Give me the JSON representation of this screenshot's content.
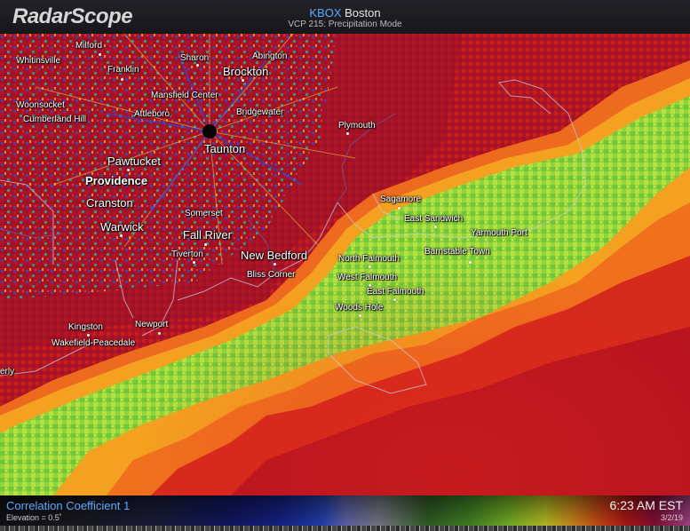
{
  "app": {
    "logo": "RadarScope"
  },
  "header": {
    "station_code": "KBOX",
    "station_name": "Boston",
    "vcp_line": "VCP 215: Precipitation Mode"
  },
  "footer": {
    "product": "Correlation Coefficient 1",
    "elevation": "Elevation = 0.5˚",
    "time": "6:23 AM EST",
    "date": "3/2/19"
  },
  "colors": {
    "accent_blue": "#5aa9ff",
    "cc_low": "#b41a1e",
    "cc_mid": "#f08a1c",
    "cc_high": "#7fd62e",
    "background_bar": "#17171b"
  },
  "places": [
    {
      "name": "Milford"
    },
    {
      "name": "Whitinsville"
    },
    {
      "name": "Franklin"
    },
    {
      "name": "Sharon"
    },
    {
      "name": "Abington"
    },
    {
      "name": "Brockton"
    },
    {
      "name": "Mansfield Center"
    },
    {
      "name": "Woonsocket"
    },
    {
      "name": "Bridgewater"
    },
    {
      "name": "Cumberland Hill"
    },
    {
      "name": "Plymouth"
    },
    {
      "name": "Attleboro"
    },
    {
      "name": "Taunton"
    },
    {
      "name": "Pawtucket"
    },
    {
      "name": "Providence"
    },
    {
      "name": "Cranston"
    },
    {
      "name": "Somerset"
    },
    {
      "name": "Warwick"
    },
    {
      "name": "Fall River"
    },
    {
      "name": "Tiverton"
    },
    {
      "name": "New Bedford"
    },
    {
      "name": "Bliss Corner"
    },
    {
      "name": "Sagamore"
    },
    {
      "name": "East Sandwich"
    },
    {
      "name": "Yarmouth Port"
    },
    {
      "name": "Barnstable Town"
    },
    {
      "name": "North Falmouth"
    },
    {
      "name": "West Falmouth"
    },
    {
      "name": "East Falmouth"
    },
    {
      "name": "Woods Hole"
    },
    {
      "name": "Kingston"
    },
    {
      "name": "Newport"
    },
    {
      "name": "Wakefield-Peacedale"
    },
    {
      "name": "erly"
    }
  ]
}
